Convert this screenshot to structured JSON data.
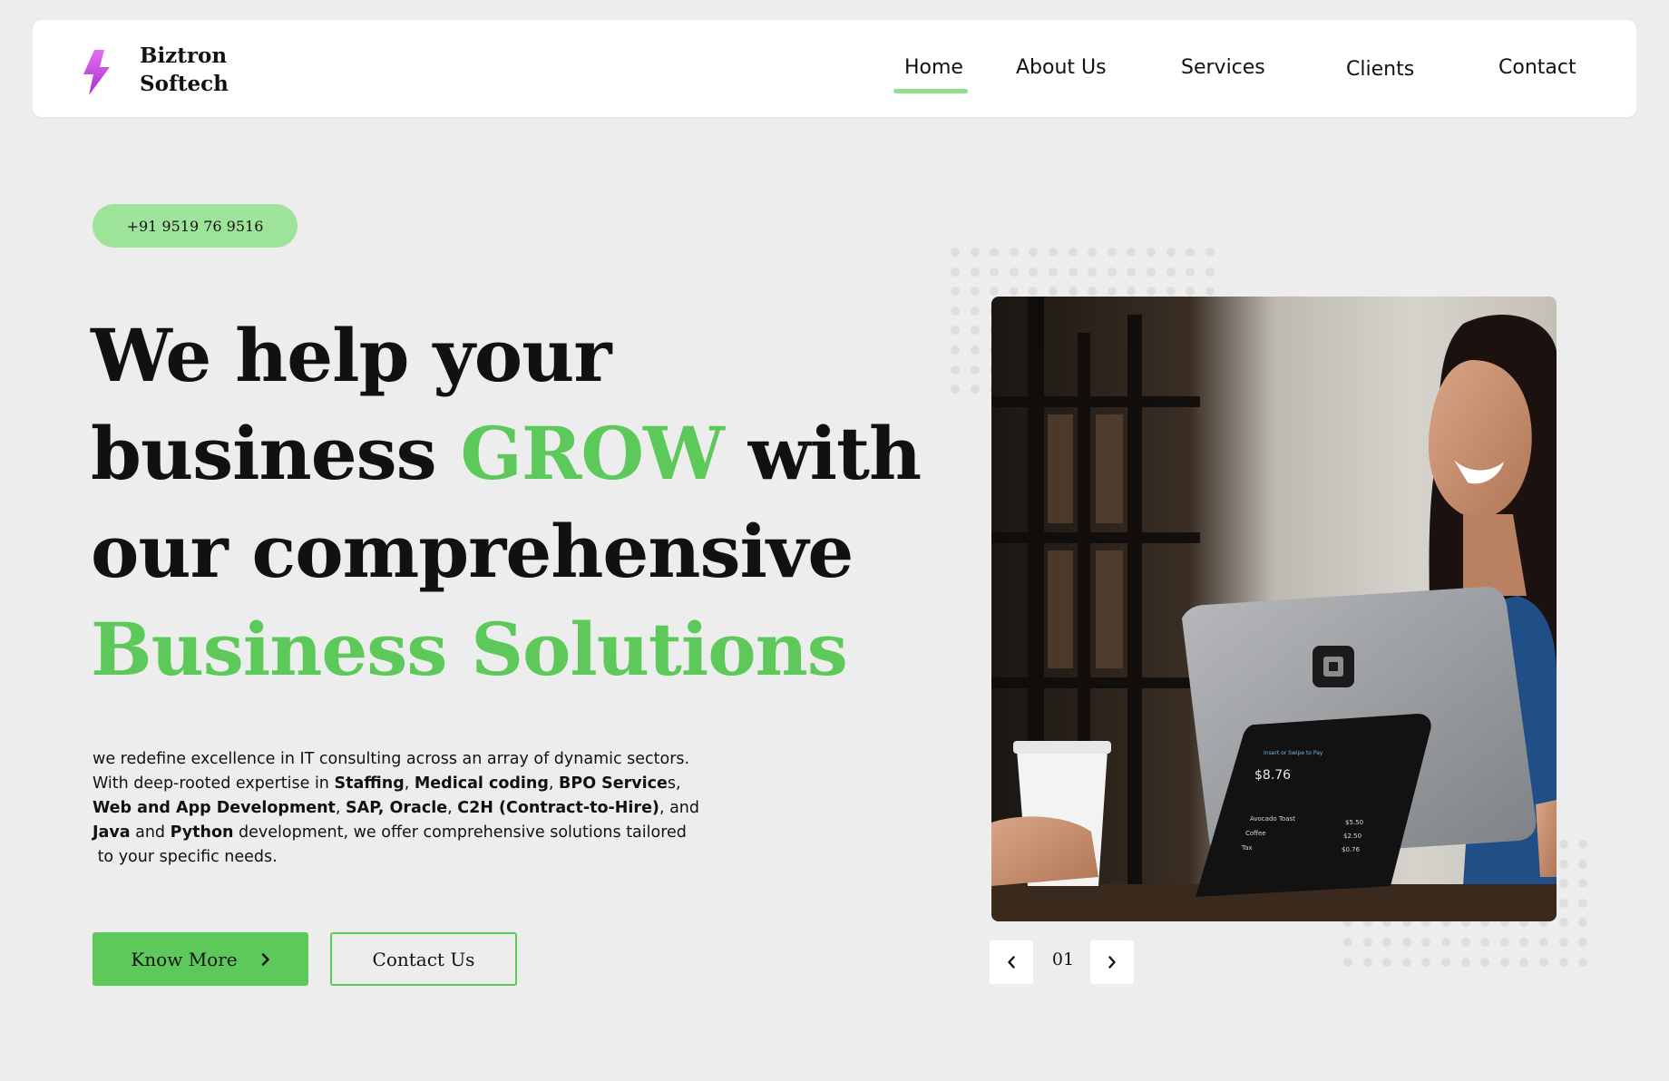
{
  "brand": {
    "line1": "Biztron",
    "line2": "Softech"
  },
  "nav": {
    "home": "Home",
    "about": "About Us",
    "services": "Services",
    "clients": "Clients",
    "contact": "Contact",
    "active": "Home"
  },
  "hero": {
    "phone": "+91 9519 76 9516",
    "headline": {
      "l1": "We help your",
      "l2a": "business ",
      "l2_green": "GROW",
      "l2b": " with",
      "l3": "our comprehensive",
      "l4_green": "Business Solutions"
    },
    "description": {
      "p1": "we redefine excellence in IT consulting across an array of dynamic sectors.",
      "p2a": "With deep-rooted expertise in ",
      "staffing": "Staffing",
      "comma1": ", ",
      "medical": "Medical coding",
      "comma2": ", ",
      "bpo": "BPO Service",
      "p2b": "s,",
      "webapp": "Web and App Development",
      "comma3": ", ",
      "sap": "SAP, Oracle",
      "comma4": ", ",
      "c2h": "C2H (Contract-to-Hire)",
      "p3b": ", and",
      "java": "Java",
      "and": " and ",
      "python": "Python",
      "p4b": " development, we offer comprehensive solutions tailored",
      "p5": " to your specific needs."
    },
    "know_more": "Know More",
    "contact_us": "Contact Us",
    "carousel_index": "01"
  },
  "screen": {
    "prompt": "Insert or Swipe to Pay",
    "total": "$8.76",
    "items": [
      {
        "name": "Avocado Toast",
        "price": "$5.50"
      },
      {
        "name": "Coffee",
        "price": "$2.50"
      },
      {
        "name": "Tax",
        "price": "$0.76"
      }
    ]
  },
  "colors": {
    "accent": "#5cc95a",
    "accent_light": "#9ee39a",
    "logo": "#c43ad8",
    "background": "#ededed"
  },
  "icons": {
    "logo": "lightning-bolt-icon",
    "arrow_right": "chevron-right-icon",
    "prev": "chevron-left-icon",
    "next": "chevron-right-icon"
  }
}
